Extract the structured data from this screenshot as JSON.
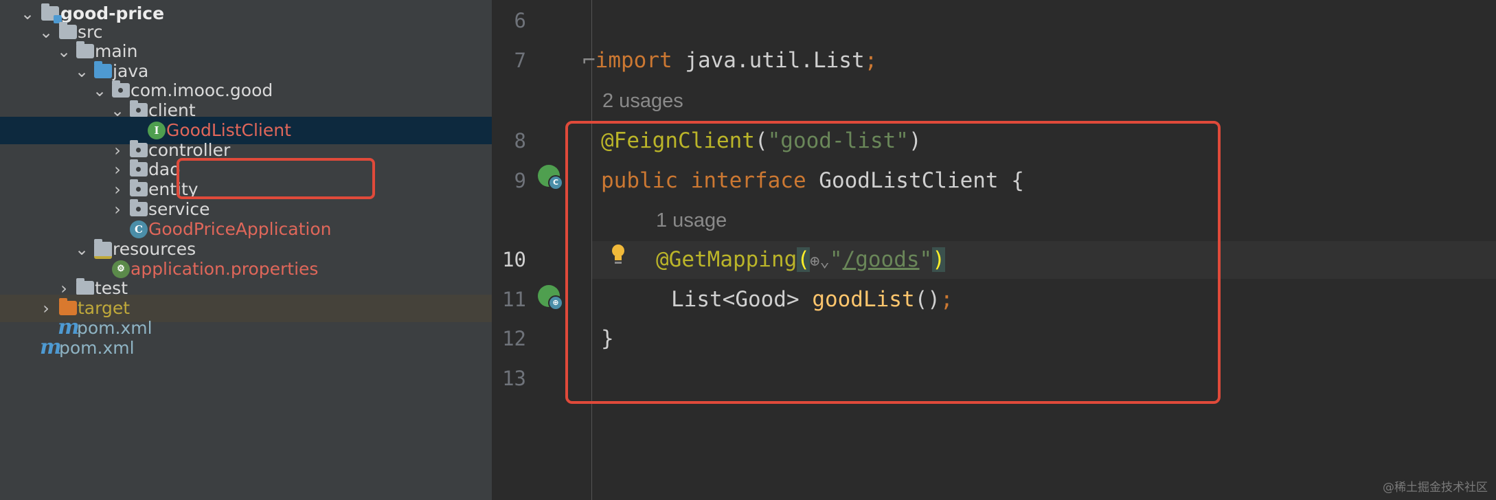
{
  "tree": {
    "items": [
      {
        "label": "good-price",
        "depth": 0
      },
      {
        "label": "src",
        "depth": 1
      },
      {
        "label": "main",
        "depth": 2
      },
      {
        "label": "java",
        "depth": 3
      },
      {
        "label": "com.imooc.good",
        "depth": 4
      },
      {
        "label": "client",
        "depth": 5
      },
      {
        "label": "GoodListClient",
        "depth": 6,
        "selected": true
      },
      {
        "label": "controller",
        "depth": 5
      },
      {
        "label": "dao",
        "depth": 5
      },
      {
        "label": "entity",
        "depth": 5
      },
      {
        "label": "service",
        "depth": 5
      },
      {
        "label": "GoodPriceApplication",
        "depth": 5
      },
      {
        "label": "resources",
        "depth": 3
      },
      {
        "label": "application.properties",
        "depth": 4
      },
      {
        "label": "test",
        "depth": 2
      },
      {
        "label": "target",
        "depth": 1
      },
      {
        "label": "pom.xml",
        "depth": 1
      },
      {
        "label": "pom.xml",
        "depth": 0
      }
    ]
  },
  "editor": {
    "line_numbers": [
      "6",
      "7",
      "8",
      "9",
      "10",
      "11",
      "12",
      "13"
    ],
    "current_line": "10",
    "line7": {
      "kw": "import",
      "rest": " java.util.List",
      "semi": ";"
    },
    "usages_2": "2 usages",
    "line8": {
      "annotation": "@FeignClient",
      "open": "(",
      "string": "\"good-list\"",
      "close": ")"
    },
    "line9": {
      "kw1": "public",
      "kw2": "interface",
      "name": " GoodListClient ",
      "brace": "{"
    },
    "usages_1": "1 usage",
    "line10": {
      "annotation": "@GetMapping",
      "open": "(",
      "q1": "\"",
      "url": "/goods",
      "q2": "\"",
      "close": ")"
    },
    "line11": {
      "type": "List<Good> ",
      "method": "goodList",
      "parens": "()",
      "semi": ";"
    },
    "line12": "}"
  },
  "watermark": "@稀土掘金技术社区",
  "colors": {
    "annotation_box": "#e04a3a",
    "selection": "#0d293e",
    "keyword": "#cc7832",
    "annotation": "#bbb529",
    "string": "#6a8759"
  },
  "icons": [
    "chevron-down-icon",
    "chevron-right-icon",
    "folder-icon",
    "module-folder-icon",
    "package-icon",
    "interface-icon",
    "spring-boot-icon",
    "properties-icon",
    "maven-icon",
    "intention-bulb-icon",
    "web-url-icon",
    "gutter-implemented-icon"
  ]
}
